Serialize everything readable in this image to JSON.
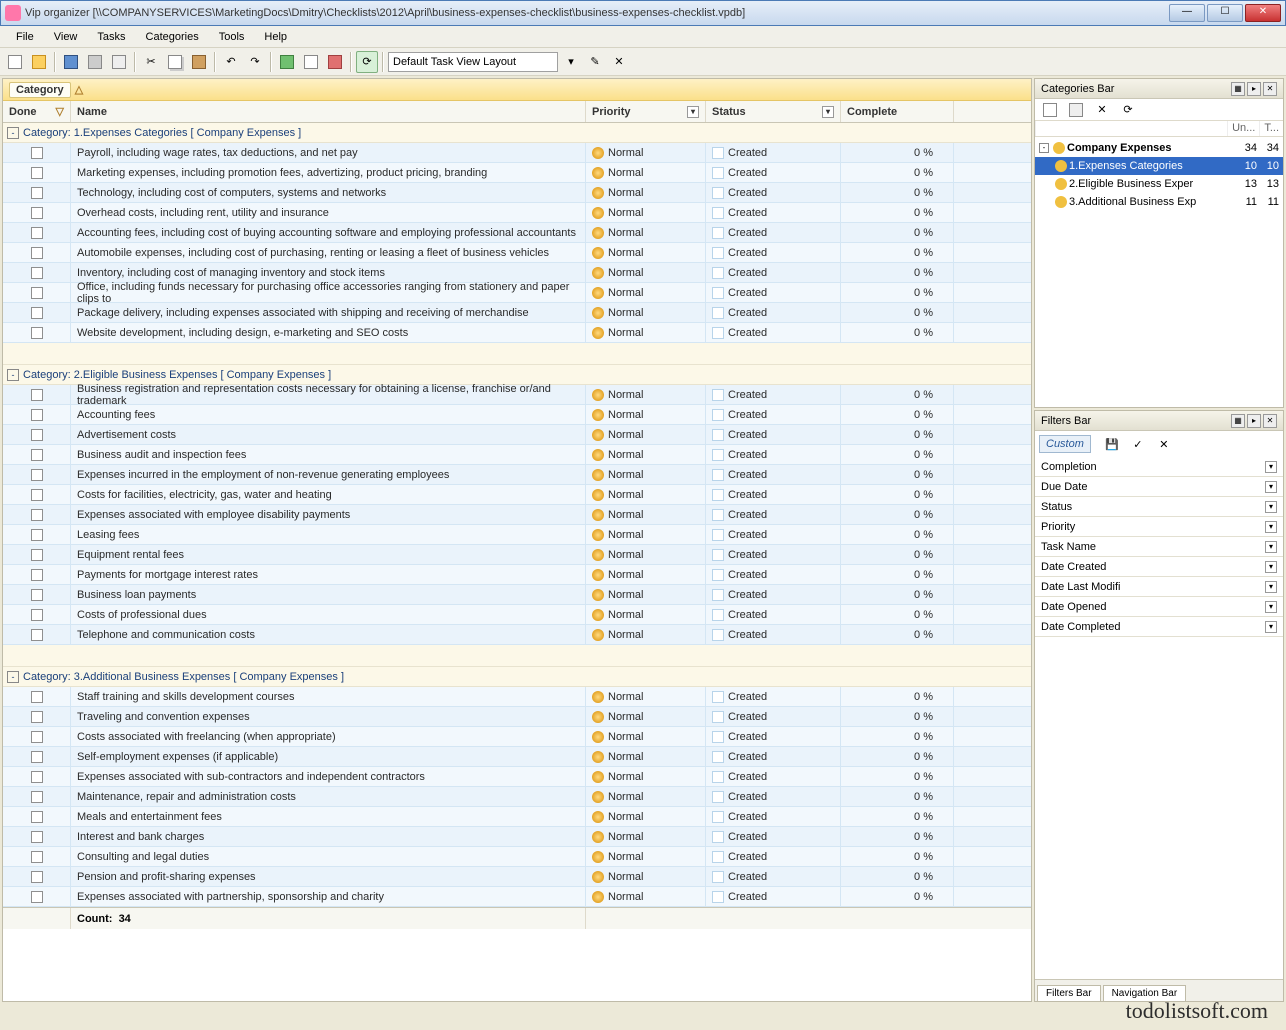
{
  "window": {
    "title": "Vip organizer [\\\\COMPANYSERVICES\\MarketingDocs\\Dmitry\\Checklists\\2012\\April\\business-expenses-checklist\\business-expenses-checklist.vpdb]"
  },
  "menu": [
    "File",
    "View",
    "Tasks",
    "Categories",
    "Tools",
    "Help"
  ],
  "toolbar": {
    "layout": "Default Task View Layout"
  },
  "grid": {
    "group_label": "Category",
    "columns": {
      "done": "Done",
      "name": "Name",
      "priority": "Priority",
      "status": "Status",
      "complete": "Complete"
    },
    "groups": [
      {
        "title": "Category: 1.Expenses Categories   [ Company Expenses ]",
        "rows": [
          {
            "name": "Payroll, including wage rates, tax deductions, and net pay",
            "priority": "Normal",
            "status": "Created",
            "complete": "0 %"
          },
          {
            "name": "Marketing expenses, including promotion fees, advertizing, product pricing, branding",
            "priority": "Normal",
            "status": "Created",
            "complete": "0 %"
          },
          {
            "name": "Technology, including cost of computers, systems and networks",
            "priority": "Normal",
            "status": "Created",
            "complete": "0 %"
          },
          {
            "name": "Overhead costs, including rent, utility and insurance",
            "priority": "Normal",
            "status": "Created",
            "complete": "0 %"
          },
          {
            "name": "Accounting fees, including cost of buying accounting software and employing professional accountants",
            "priority": "Normal",
            "status": "Created",
            "complete": "0 %"
          },
          {
            "name": "Automobile expenses, including cost of purchasing, renting or leasing a fleet of business vehicles",
            "priority": "Normal",
            "status": "Created",
            "complete": "0 %"
          },
          {
            "name": "Inventory, including cost of managing inventory and stock items",
            "priority": "Normal",
            "status": "Created",
            "complete": "0 %"
          },
          {
            "name": "Office, including funds necessary for purchasing office accessories ranging from stationery and paper clips to",
            "priority": "Normal",
            "status": "Created",
            "complete": "0 %"
          },
          {
            "name": "Package delivery, including expenses associated with shipping and receiving of merchandise",
            "priority": "Normal",
            "status": "Created",
            "complete": "0 %"
          },
          {
            "name": "Website development, including design, e-marketing and SEO costs",
            "priority": "Normal",
            "status": "Created",
            "complete": "0 %"
          }
        ]
      },
      {
        "title": "Category: 2.Eligible Business Expenses   [ Company Expenses ]",
        "rows": [
          {
            "name": "Business registration and representation costs necessary for obtaining a license, franchise or/and trademark",
            "priority": "Normal",
            "status": "Created",
            "complete": "0 %"
          },
          {
            "name": "Accounting fees",
            "priority": "Normal",
            "status": "Created",
            "complete": "0 %"
          },
          {
            "name": "Advertisement costs",
            "priority": "Normal",
            "status": "Created",
            "complete": "0 %"
          },
          {
            "name": "Business audit and inspection fees",
            "priority": "Normal",
            "status": "Created",
            "complete": "0 %"
          },
          {
            "name": "Expenses incurred in the employment of non-revenue generating employees",
            "priority": "Normal",
            "status": "Created",
            "complete": "0 %"
          },
          {
            "name": "Costs for facilities, electricity, gas, water and heating",
            "priority": "Normal",
            "status": "Created",
            "complete": "0 %"
          },
          {
            "name": "Expenses associated with employee disability payments",
            "priority": "Normal",
            "status": "Created",
            "complete": "0 %"
          },
          {
            "name": "Leasing fees",
            "priority": "Normal",
            "status": "Created",
            "complete": "0 %"
          },
          {
            "name": "Equipment rental fees",
            "priority": "Normal",
            "status": "Created",
            "complete": "0 %"
          },
          {
            "name": "Payments for mortgage interest rates",
            "priority": "Normal",
            "status": "Created",
            "complete": "0 %"
          },
          {
            "name": "Business loan payments",
            "priority": "Normal",
            "status": "Created",
            "complete": "0 %"
          },
          {
            "name": "Costs of professional dues",
            "priority": "Normal",
            "status": "Created",
            "complete": "0 %"
          },
          {
            "name": "Telephone and communication costs",
            "priority": "Normal",
            "status": "Created",
            "complete": "0 %"
          }
        ]
      },
      {
        "title": "Category: 3.Additional Business Expenses   [ Company Expenses ]",
        "rows": [
          {
            "name": "Staff training and skills development courses",
            "priority": "Normal",
            "status": "Created",
            "complete": "0 %"
          },
          {
            "name": "Traveling and convention expenses",
            "priority": "Normal",
            "status": "Created",
            "complete": "0 %"
          },
          {
            "name": "Costs associated with freelancing (when appropriate)",
            "priority": "Normal",
            "status": "Created",
            "complete": "0 %"
          },
          {
            "name": "Self-employment expenses (if applicable)",
            "priority": "Normal",
            "status": "Created",
            "complete": "0 %"
          },
          {
            "name": "Expenses associated with sub-contractors and independent contractors",
            "priority": "Normal",
            "status": "Created",
            "complete": "0 %"
          },
          {
            "name": "Maintenance, repair and administration costs",
            "priority": "Normal",
            "status": "Created",
            "complete": "0 %"
          },
          {
            "name": "Meals and entertainment fees",
            "priority": "Normal",
            "status": "Created",
            "complete": "0 %"
          },
          {
            "name": "Interest and bank charges",
            "priority": "Normal",
            "status": "Created",
            "complete": "0 %"
          },
          {
            "name": "Consulting and legal duties",
            "priority": "Normal",
            "status": "Created",
            "complete": "0 %"
          },
          {
            "name": "Pension and profit-sharing expenses",
            "priority": "Normal",
            "status": "Created",
            "complete": "0 %"
          },
          {
            "name": "Expenses associated with partnership, sponsorship and charity",
            "priority": "Normal",
            "status": "Created",
            "complete": "0 %"
          }
        ]
      }
    ],
    "footer": {
      "count_label": "Count:",
      "count": "34"
    }
  },
  "categories_panel": {
    "title": "Categories Bar",
    "cols": [
      "Un...",
      "T..."
    ],
    "tree": [
      {
        "label": "Company Expenses",
        "n1": "34",
        "n2": "34",
        "selected": false,
        "indent": 0
      },
      {
        "label": "1.Expenses Categories",
        "n1": "10",
        "n2": "10",
        "selected": true,
        "indent": 1
      },
      {
        "label": "2.Eligible Business Exper",
        "n1": "13",
        "n2": "13",
        "selected": false,
        "indent": 1
      },
      {
        "label": "3.Additional Business Exp",
        "n1": "11",
        "n2": "11",
        "selected": false,
        "indent": 1
      }
    ]
  },
  "filters_panel": {
    "title": "Filters Bar",
    "chip": "Custom",
    "rows": [
      "Completion",
      "Due Date",
      "Status",
      "Priority",
      "Task Name",
      "Date Created",
      "Date Last Modifi",
      "Date Opened",
      "Date Completed"
    ],
    "tabs": [
      "Filters Bar",
      "Navigation Bar"
    ]
  },
  "watermark": "todolistsoft.com"
}
